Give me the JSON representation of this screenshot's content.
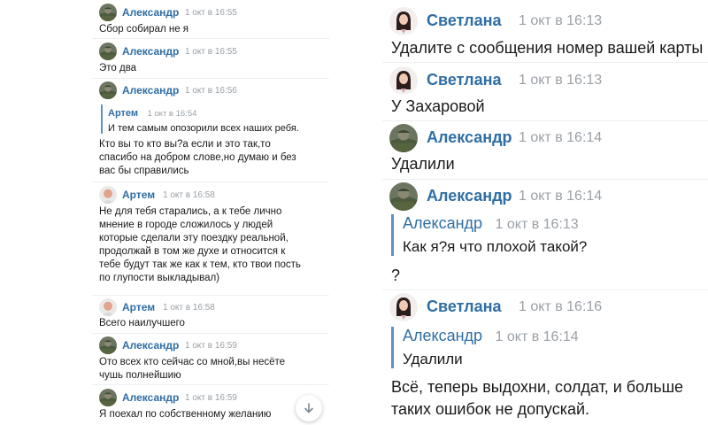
{
  "left_chat": {
    "messages": [
      {
        "author": "Александр",
        "time": "1 окт в 16:55",
        "avatar": "soldier-avatar",
        "text": "Сбор собирал не я"
      },
      {
        "author": "Александр",
        "time": "1 окт в 16:55",
        "avatar": "soldier-avatar",
        "text": "Это два"
      },
      {
        "author": "Александр",
        "time": "1 окт в 16:56",
        "avatar": "soldier-avatar",
        "quote": {
          "author": "Артем",
          "time": "1 окт в 16:54",
          "text": "И тем самым опозорили всех наших ребя."
        },
        "text": "Кто вы то кто вы?а если и это так,то\nспасибо на добром слове,но думаю и без\nвас бы справились"
      },
      {
        "author": "Артем",
        "time": "1 окт в 16:58",
        "avatar": "man-avatar",
        "text": "Не для тебя старались, а к тебе лично\nмнение в городе сложилось у людей\nкоторые сделали эту поездку реальной,\nпродолжай в том же духе и относится к\nтебе будут так же как к тем, кто твои пость\nпо глупости выкладывал)"
      },
      {
        "author": "Артем",
        "time": "1 окт в 16:58",
        "avatar": "man-avatar",
        "text": "Всего наилучшего"
      },
      {
        "author": "Александр",
        "time": "1 окт в 16:59",
        "avatar": "soldier-avatar",
        "text": "Ото всех кто сейчас со мной,вы несёте\nчушь полнейшию"
      },
      {
        "author": "Александр",
        "time": "1 окт в 16:59",
        "avatar": "soldier-avatar",
        "text": "Я поехал по собственному желанию"
      }
    ],
    "scroll_icon": "chevron-down-icon"
  },
  "right_chat": {
    "messages": [
      {
        "author": "Светлана",
        "time": "1 окт в 16:13",
        "avatar": "woman-avatar",
        "text": "Удалите с сообщения номер вашей карты"
      },
      {
        "author": "Светлана",
        "time": "1 окт в 16:13",
        "avatar": "woman-avatar",
        "text": "У Захаровой"
      },
      {
        "author": "Александр",
        "time": "1 окт в 16:14",
        "avatar": "soldier-avatar",
        "text": "Удалили"
      },
      {
        "author": "Александр",
        "time": "1 окт в 16:14",
        "avatar": "soldier-avatar",
        "quote": {
          "author": "Александр",
          "time": "1 окт в 16:13",
          "text": "Как я?я что плохой такой?"
        },
        "text": "?"
      },
      {
        "author": "Светлана",
        "time": "1 окт в 16:16",
        "avatar": "woman-avatar",
        "quote": {
          "author": "Александр",
          "time": "1 окт в 16:14",
          "text": "Удалили"
        },
        "text": "Всё, теперь выдохни, солдат, и больше\nтаких ошибок не допускай."
      }
    ]
  },
  "colors": {
    "name": "#2f6ea5",
    "time": "#9aa0a6",
    "quote_bar": "#5d91c7",
    "text": "#1a1a1a"
  }
}
